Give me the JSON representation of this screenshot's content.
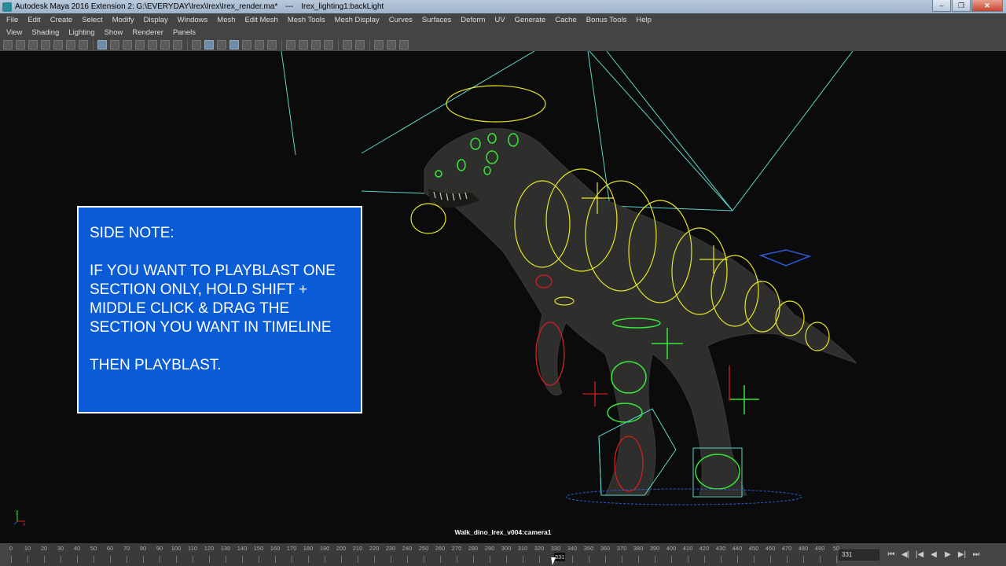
{
  "window": {
    "title": "Autodesk Maya 2016 Extension 2: G:\\EVERYDAY\\Irex\\Irex\\Irex_render.ma*",
    "separator": "---",
    "subtitle": "Irex_lighting1:backLight"
  },
  "menubar": [
    "File",
    "Edit",
    "Create",
    "Select",
    "Modify",
    "Display",
    "Windows",
    "Mesh",
    "Edit Mesh",
    "Mesh Tools",
    "Mesh Display",
    "Curves",
    "Surfaces",
    "Deform",
    "UV",
    "Generate",
    "Cache",
    "Bonus Tools",
    "Help"
  ],
  "panel_menu": [
    "View",
    "Shading",
    "Lighting",
    "Show",
    "Renderer",
    "Panels"
  ],
  "side_note": {
    "heading": "SIDE NOTE:",
    "body": "IF YOU WANT TO PLAYBLAST ONE SECTION ONLY, HOLD SHIFT + MIDDLE CLICK & DRAG THE SECTION YOU WANT IN TIMELINE",
    "footer": "THEN PLAYBLAST."
  },
  "viewport": {
    "camera_label": "Walk_dino_Irex_v004:camera1",
    "axis_y": "y",
    "axis_x": "x"
  },
  "timeline": {
    "ticks": [
      "0",
      "10",
      "20",
      "30",
      "40",
      "50",
      "60",
      "70",
      "80",
      "90",
      "100",
      "110",
      "120",
      "130",
      "140",
      "150",
      "160",
      "170",
      "180",
      "190",
      "200",
      "210",
      "220",
      "230",
      "240",
      "250",
      "260",
      "270",
      "280",
      "290",
      "300",
      "310",
      "320",
      "330",
      "340",
      "350",
      "360",
      "370",
      "380",
      "390",
      "400",
      "410",
      "420",
      "430",
      "440",
      "450",
      "460",
      "470",
      "480",
      "490",
      "50"
    ],
    "current_frame_marker": "331",
    "current_frame": "331"
  },
  "colors": {
    "note_bg": "#0a5bd6",
    "control_yellow": "#e6e62a",
    "control_green": "#38e838",
    "control_red": "#d81e1e",
    "light_cyan": "#5fd6c8"
  }
}
